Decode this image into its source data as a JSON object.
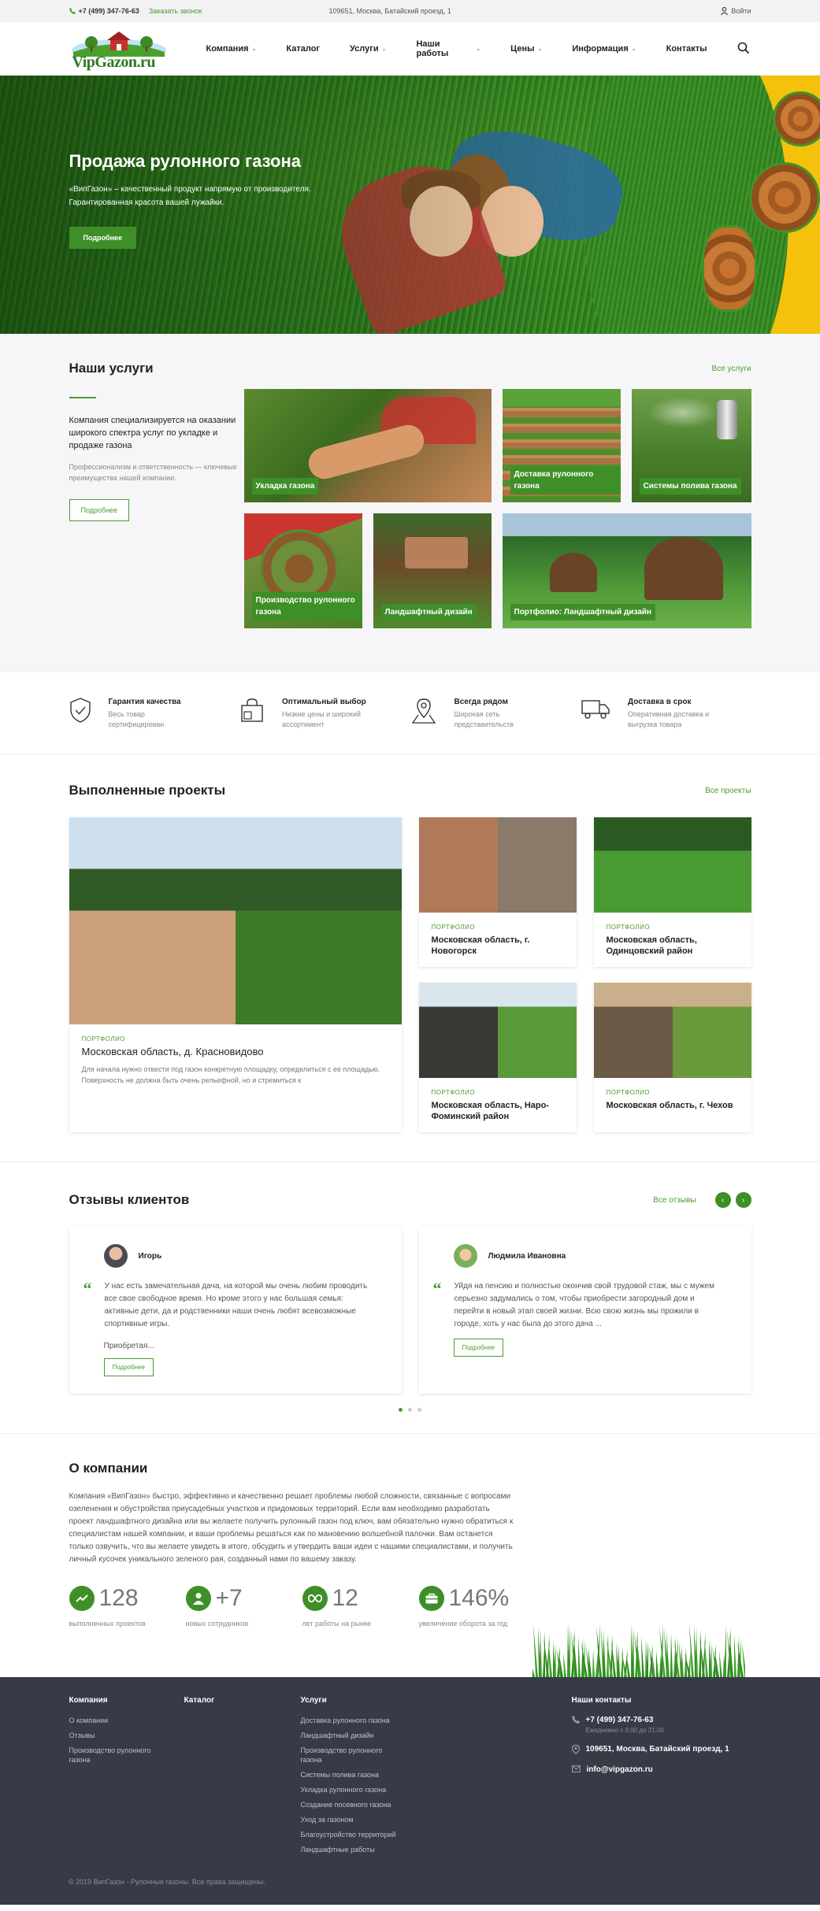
{
  "topbar": {
    "phone": "+7 (499) 347-76-63",
    "callback": "Заказать звонок",
    "address": "109651, Москва, Батайский проезд, 1",
    "login": "Войти"
  },
  "header": {
    "logo_text": "VipGazon.ru",
    "nav": [
      {
        "label": "Компания",
        "dropdown": true
      },
      {
        "label": "Каталог",
        "dropdown": false
      },
      {
        "label": "Услуги",
        "dropdown": true
      },
      {
        "label": "Наши работы",
        "dropdown": true
      },
      {
        "label": "Цены",
        "dropdown": true
      },
      {
        "label": "Информация",
        "dropdown": true
      },
      {
        "label": "Контакты",
        "dropdown": false
      }
    ]
  },
  "hero": {
    "title": "Продажа рулонного газона",
    "subtitle": "«ВипГазон» – качественный продукт напрямую от производителя. Гарантированная красота вашей лужайки.",
    "button": "Подробнее"
  },
  "services": {
    "title": "Наши услуги",
    "all_link": "Все услуги",
    "lead": "Компания специализируется на оказании широкого спектра услуг по укладке и продаже газона",
    "sub": "Профессионализм и ответственность — ключевые преимущества нашей компании.",
    "button": "Подробнее",
    "tiles": [
      {
        "label": "Укладка газона"
      },
      {
        "label": "Доставка рулонного газона"
      },
      {
        "label": "Системы полива газона"
      },
      {
        "label": "Производство рулонного газона"
      },
      {
        "label": "Ландшафтный дизайн"
      },
      {
        "label": "Портфолио: Ландшафтный дизайн"
      }
    ]
  },
  "features": [
    {
      "title": "Гарантия качества",
      "desc": "Весь товар сертифицирован",
      "icon": "shield-check-icon"
    },
    {
      "title": "Оптимальный выбор",
      "desc": "Низкие цены и широкий ассортимент",
      "icon": "shopping-bag-icon"
    },
    {
      "title": "Всегда рядом",
      "desc": "Широкая сеть представительств",
      "icon": "map-pin-icon"
    },
    {
      "title": "Доставка в срок",
      "desc": "Оперативная доставка и выгрузка товара",
      "icon": "truck-icon"
    }
  ],
  "projects": {
    "title": "Выполненные проекты",
    "all_link": "Все проекты",
    "items": [
      {
        "kicker": "ПОРТФОЛИО",
        "name": "Московская область, д. Красновидово",
        "desc": "Для начала нужно отвести под газон конкретную площадку, определиться с ее площадью. Поверхность не должна быть очень рельефной, но и стремиться к"
      },
      {
        "kicker": "ПОРТФОЛИО",
        "name": "Московская область, г. Новогорск"
      },
      {
        "kicker": "ПОРТФОЛИО",
        "name": "Московская область, Одинцовский район"
      },
      {
        "kicker": "ПОРТФОЛИО",
        "name": "Московская область, Наро-Фоминский район"
      },
      {
        "kicker": "ПОРТФОЛИО",
        "name": "Московская область, г. Чехов"
      }
    ]
  },
  "reviews": {
    "title": "Отзывы клиентов",
    "all_link": "Все отзывы",
    "prev": "‹",
    "next": "›",
    "items": [
      {
        "name": "Игорь",
        "text": "У нас есть замечательная дача, на которой мы очень любим проводить все свое свободное время. Но кроме этого у нас большая семья: активные дети, да и родственники наши очень любят всевозможные спортивные игры.",
        "more": "Приобретая...",
        "button": "Подробнее"
      },
      {
        "name": "Людмила Ивановна",
        "text": "Уйдя на пенсию и полностью окончив свой трудовой стаж, мы с мужем серьезно задумались о том, чтобы приобрести загородный дом и перейти в новый этап своей жизни. Всю свою жизнь мы прожили в городе, хоть у нас была до этого дача ...",
        "more": "",
        "button": "Подробнее"
      }
    ]
  },
  "about": {
    "title": "О компании",
    "text": "Компания «ВипГазон» быстро, эффективно и качественно решает проблемы любой сложности, связанные с вопросами озеленения и обустройства приусадебных участков и придомовых территорий. Если вам необходимо разработать проект ландшафтного дизайна или вы желаете получить рулонный газон под ключ, вам обязательно нужно обратиться к специалистам нашей компании, и ваши проблемы решаться как по мановению волшебной палочки. Вам останется только озвучить, что вы желаете увидеть в итоге, обсудить и утвердить ваши идеи с нашими специалистами, и получить личный кусочек уникального зеленого рая, созданный нами по вашему заказу.",
    "stats": [
      {
        "value": "128",
        "caption": "выполненных проектов",
        "icon": "trend-up-icon"
      },
      {
        "value": "+7",
        "caption": "новых сотрудников",
        "icon": "user-icon"
      },
      {
        "value": "12",
        "caption": "лет работы на рынке",
        "icon": "infinity-icon"
      },
      {
        "value": "146%",
        "caption": "увеличение оборота за год",
        "icon": "briefcase-icon"
      }
    ]
  },
  "footer": {
    "cols": [
      {
        "title": "Компания",
        "links": [
          "О компании",
          "Отзывы",
          "Производство рулонного газона"
        ]
      },
      {
        "title": "Каталог",
        "links": []
      },
      {
        "title": "Услуги",
        "links": [
          "Доставка рулонного газона",
          "Ландшафтный дизайн",
          "Производство рулонного газона",
          "Системы полива газона",
          "Укладка рулонного газона",
          "Создание посевного газона",
          "Уход за газоном",
          "Благоустройство территорий",
          "Ландшафтные работы"
        ]
      }
    ],
    "contacts_title": "Наши контакты",
    "phone": "+7 (499) 347-76-63",
    "hours": "Ежедневно с 9:00 до 21:00",
    "address": "109651, Москва, Батайский проезд, 1",
    "email": "info@vipgazon.ru",
    "copyright": "© 2019 ВипГазон - Рулонные газоны. Все права защищены."
  }
}
